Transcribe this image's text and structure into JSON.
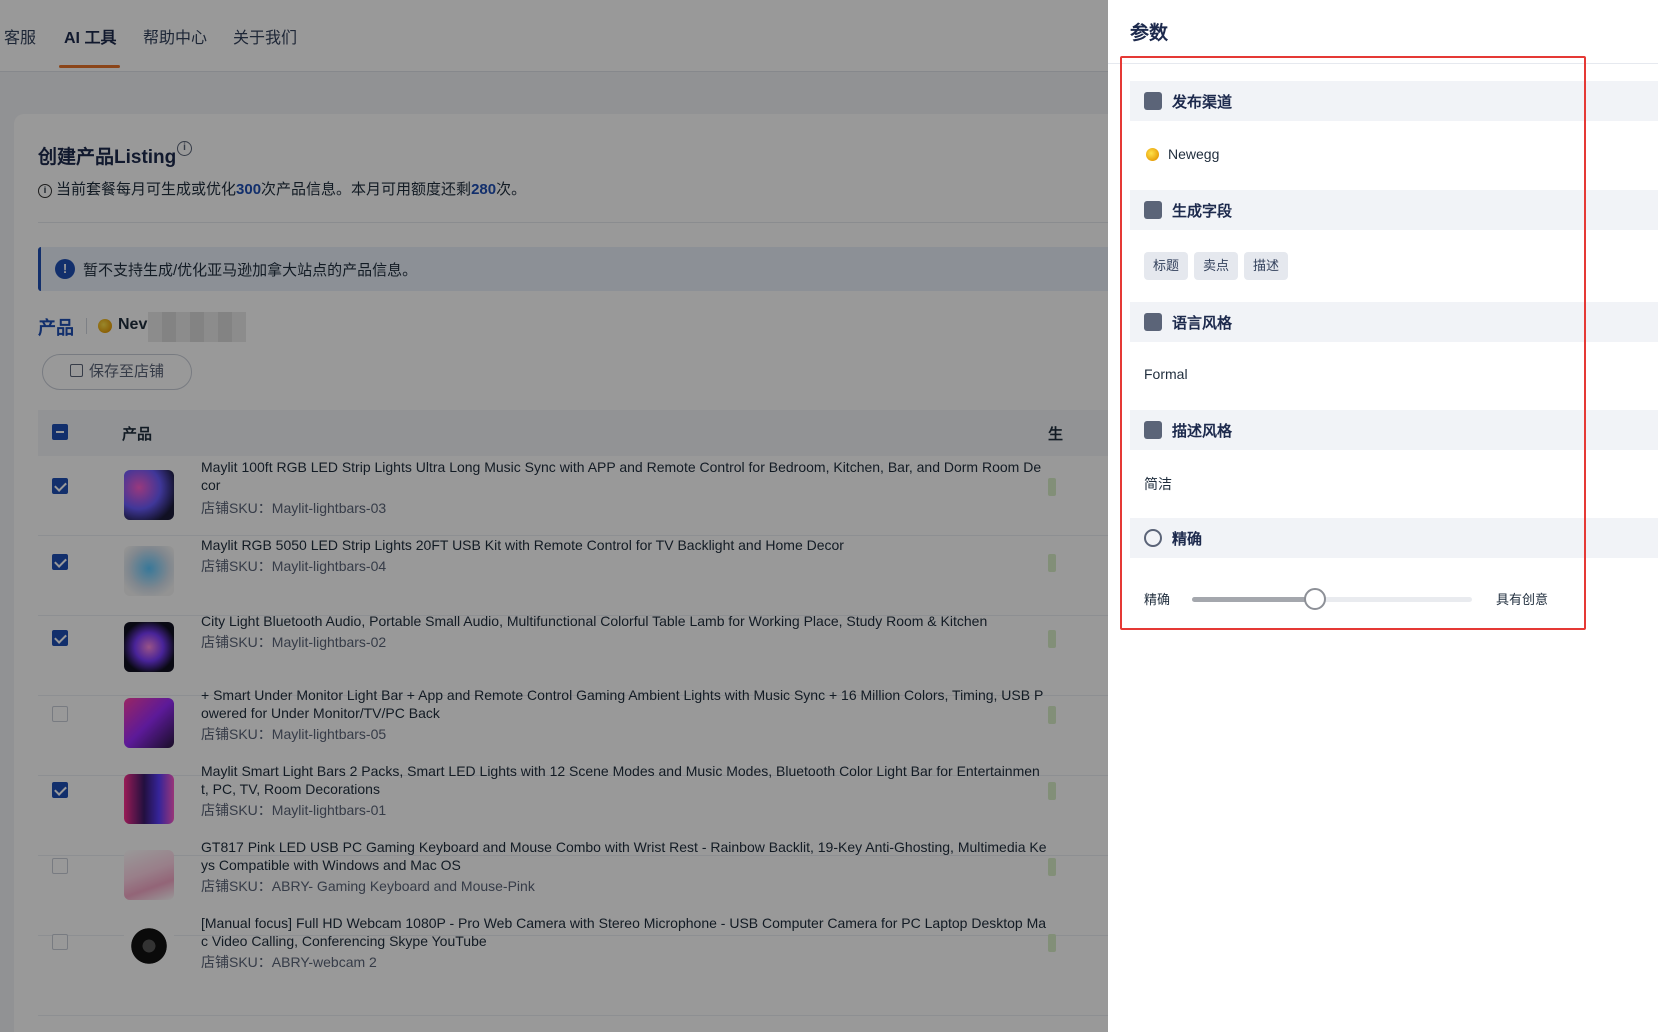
{
  "nav": {
    "items": [
      "客服",
      "AI 工具",
      "帮助中心",
      "关于我们"
    ],
    "active": "AI 工具"
  },
  "card": {
    "title": "创建产品Listing",
    "quota": {
      "prefix": "当前套餐每月可生成或优化",
      "total": "300",
      "mid": "次产品信息。本月可用额度还剩",
      "remaining": "280",
      "suffix": "次。"
    },
    "notice": "暂不支持生成/优化亚马逊加拿大站点的产品信息。",
    "product_tab": "产品",
    "channel_short": "Nev",
    "save_button": "保存至店铺",
    "table": {
      "col_product": "产品",
      "col_generate": "生",
      "rows": [
        {
          "checked": true,
          "title": "Maylit 100ft RGB LED Strip Lights Ultra Long Music Sync with APP and Remote Control for Bedroom, Kitchen, Bar, and Dorm Room Decor",
          "sku": "店铺SKU：Maylit-lightbars-03"
        },
        {
          "checked": true,
          "title": "Maylit RGB 5050 LED Strip Lights 20FT USB Kit with Remote Control for TV Backlight and Home Decor",
          "sku": "店铺SKU：Maylit-lightbars-04"
        },
        {
          "checked": true,
          "title": "City Light Bluetooth Audio, Portable Small Audio, Multifunctional Colorful Table Lamb for Working Place, Study Room & Kitchen",
          "sku": "店铺SKU：Maylit-lightbars-02"
        },
        {
          "checked": false,
          "title": "+ Smart Under Monitor Light Bar + App and Remote Control Gaming Ambient Lights with Music Sync + 16 Million Colors, Timing, USB Powered for Under Monitor/TV/PC Back",
          "sku": "店铺SKU：Maylit-lightbars-05"
        },
        {
          "checked": true,
          "title": "Maylit Smart Light Bars 2 Packs, Smart LED Lights with 12 Scene Modes and Music Modes, Bluetooth Color Light Bar for Entertainment, PC, TV, Room Decorations",
          "sku": "店铺SKU：Maylit-lightbars-01"
        },
        {
          "checked": false,
          "title": "GT817 Pink LED USB PC Gaming Keyboard and Mouse Combo with Wrist Rest - Rainbow Backlit, 19-Key Anti-Ghosting, Multimedia Keys Compatible with Windows and Mac OS",
          "sku": "店铺SKU：ABRY- Gaming Keyboard and Mouse-Pink"
        },
        {
          "checked": false,
          "title": "[Manual focus] Full HD Webcam 1080P - Pro Web Camera with Stereo Microphone - USB Computer Camera for PC Laptop Desktop Mac Video Calling, Conferencing Skype YouTube",
          "sku": "店铺SKU：ABRY-webcam 2"
        }
      ]
    }
  },
  "drawer": {
    "title": "参数",
    "sections": {
      "channel": {
        "label": "发布渠道",
        "icon": "store-icon",
        "value": "Newegg"
      },
      "fields": {
        "label": "生成字段",
        "icon": "list-icon",
        "tags": [
          "标题",
          "卖点",
          "描述"
        ]
      },
      "language": {
        "label": "语言风格",
        "icon": "star-icon",
        "value": "Formal"
      },
      "description": {
        "label": "描述风格",
        "icon": "text-lines-icon",
        "value": "简洁"
      },
      "precision": {
        "label": "精确",
        "icon": "lightbulb-icon",
        "left": "精确",
        "right": "具有创意",
        "level": 0.44
      }
    }
  },
  "colors": {
    "accent": "#1f4fb5",
    "nav_underline": "#e8742a",
    "highlight": "#e53935"
  }
}
